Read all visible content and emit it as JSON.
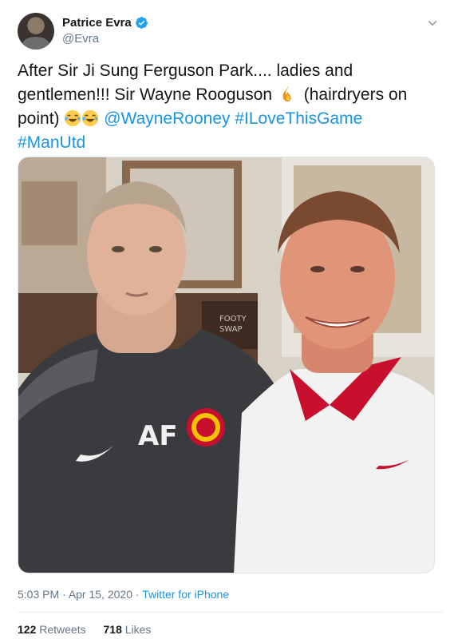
{
  "tweet": {
    "author": {
      "display_name": "Patrice Evra",
      "handle": "@Evra",
      "verified": true
    },
    "text_parts": {
      "part1": "After Sir Ji Sung Ferguson Park.... ladies and gentlemen!!! Sir Wayne Rooguson",
      "part2": "(hairdryers on point)",
      "mention": "@WayneRooney",
      "hashtag1": "#ILoveThisGame",
      "hashtag2": "#ManUtd"
    },
    "emojis": [
      "fire",
      "face-with-tears-of-joy",
      "face-with-tears-of-joy"
    ],
    "photo": {
      "shirt_left_initials": "AF",
      "background_sign": "FOOTY SWAP"
    },
    "meta": {
      "time": "5:03 PM",
      "separator": " · ",
      "date": "Apr 15, 2020",
      "source": "Twitter for iPhone"
    },
    "stats": {
      "retweets_count": "122",
      "retweets_label": "Retweets",
      "likes_count": "718",
      "likes_label": "Likes"
    }
  },
  "colors": {
    "link": "#1b95e0",
    "text": "#14171a",
    "muted": "#657786",
    "verified": "#1da1f2"
  }
}
